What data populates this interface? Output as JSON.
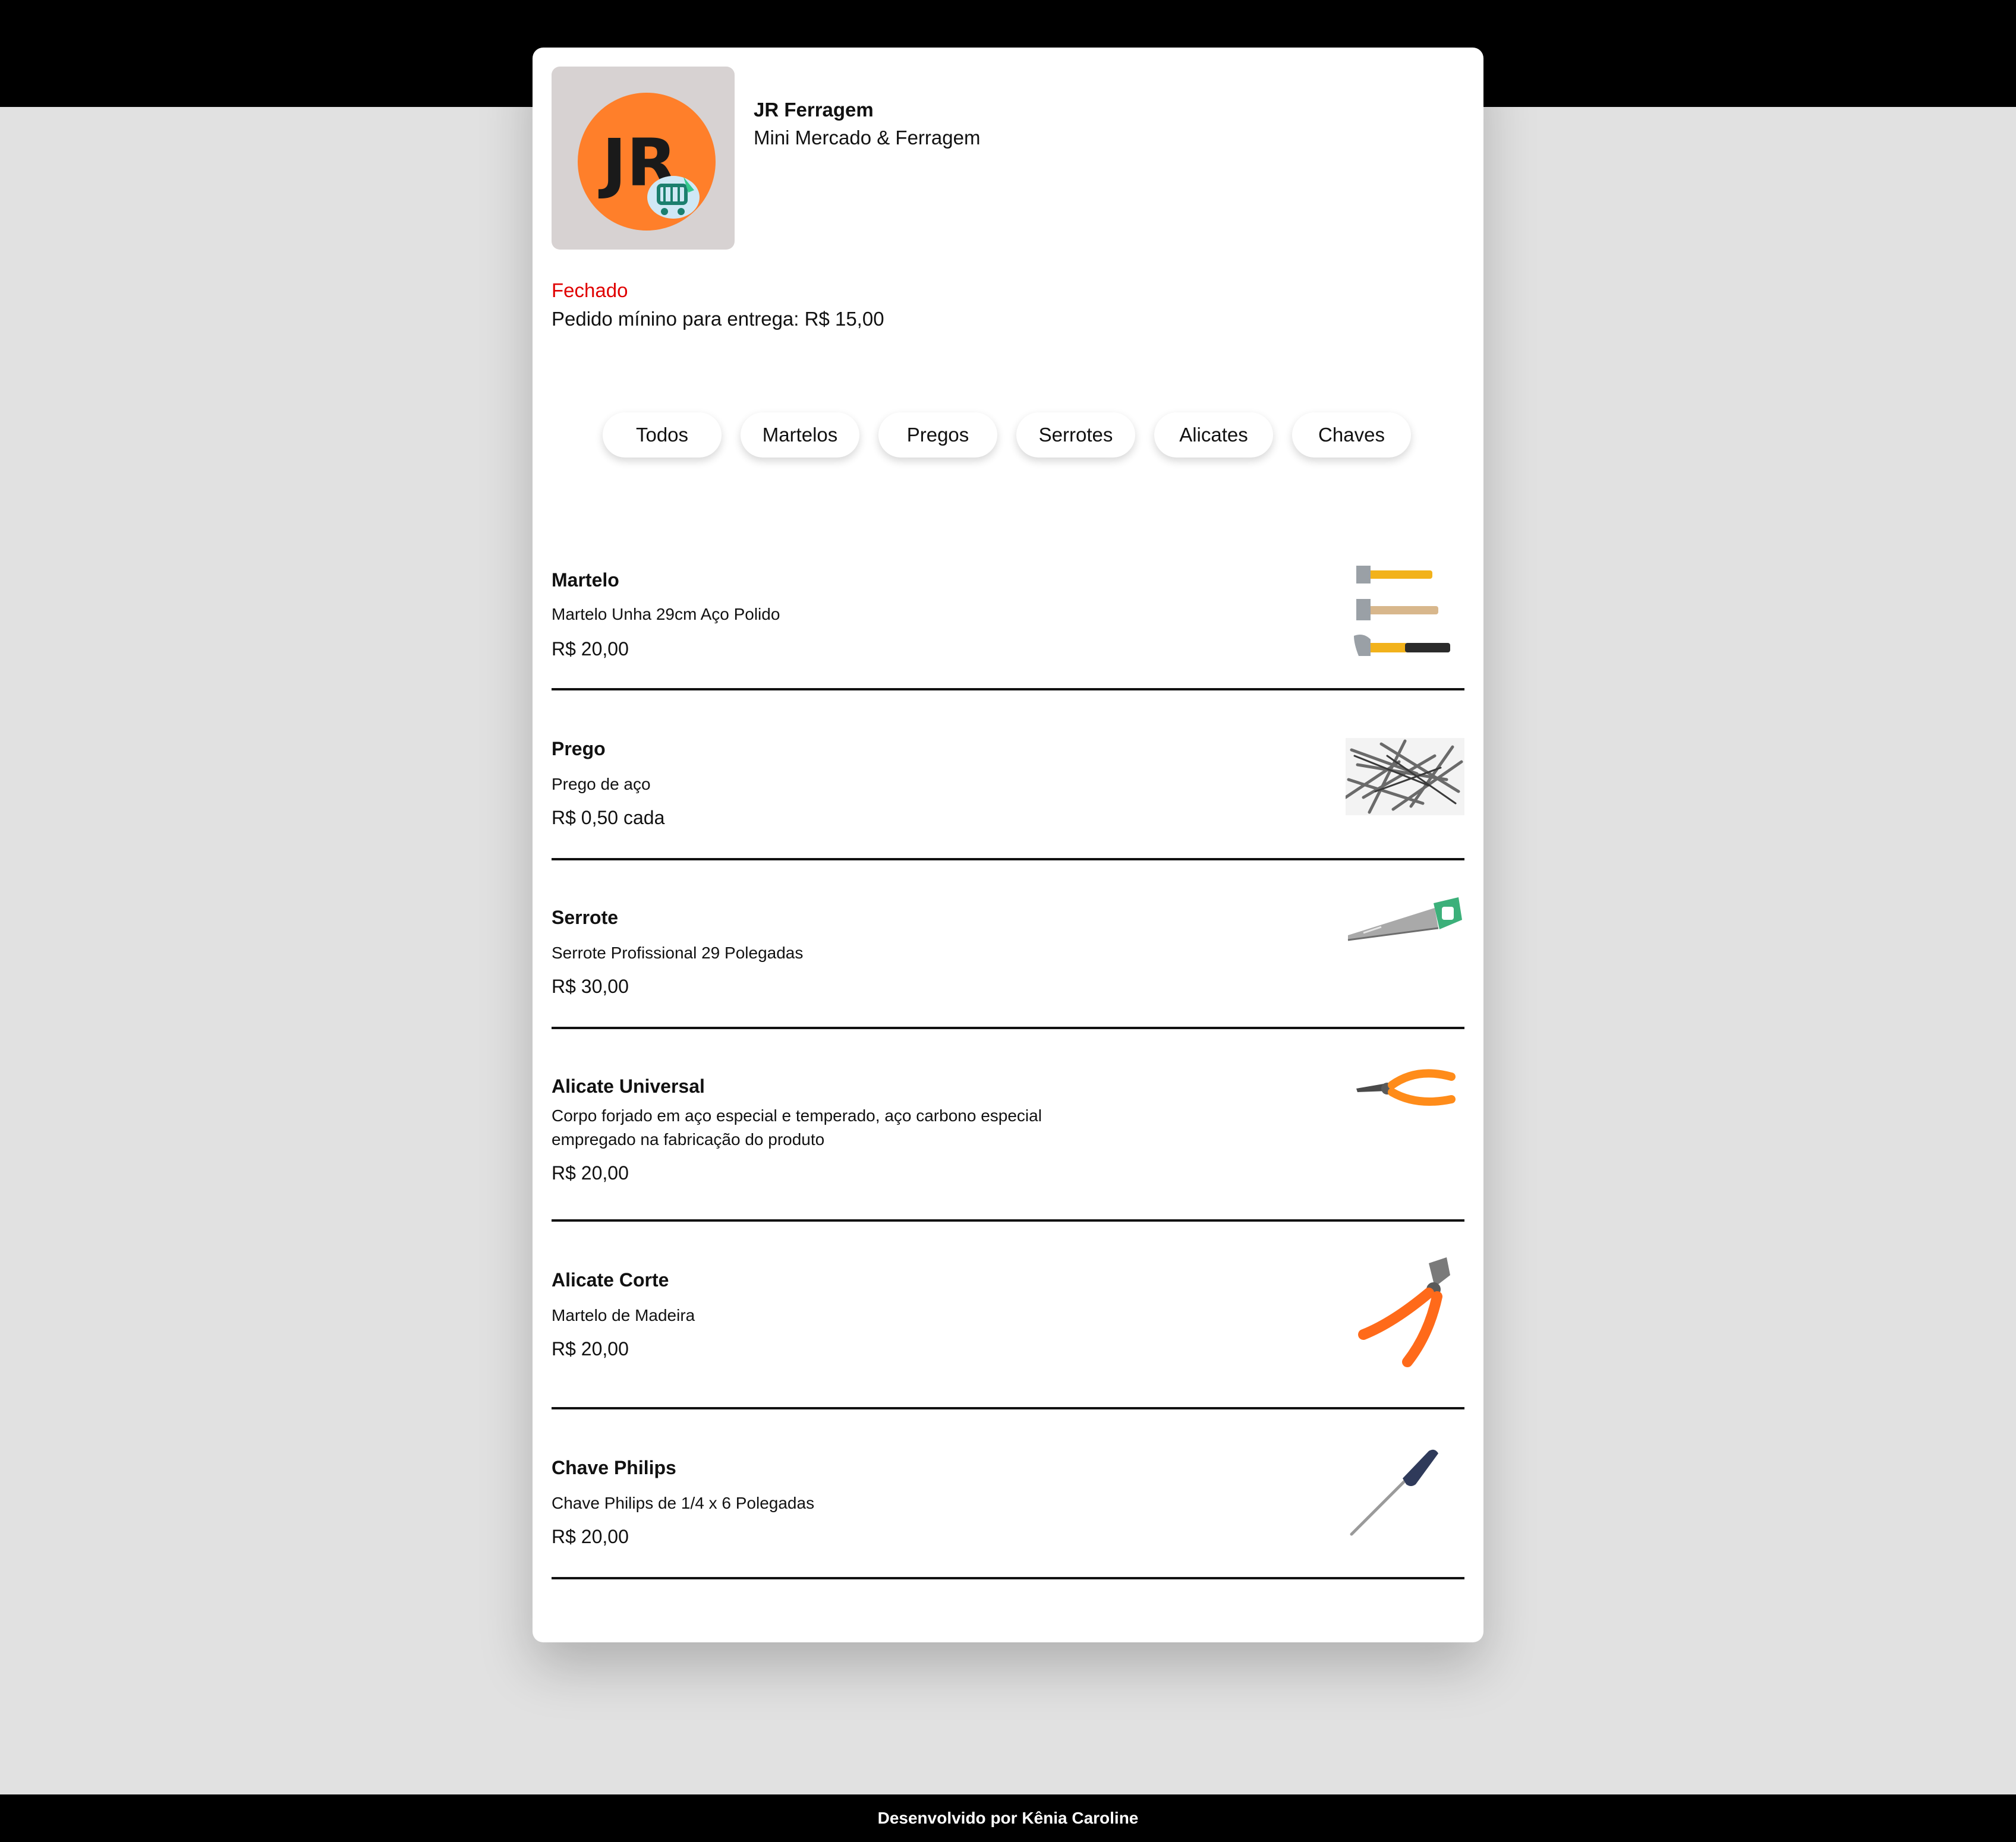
{
  "store": {
    "logo_text": "JR",
    "name": "JR Ferragem",
    "subtitle": "Mini Mercado & Ferragem",
    "status": "Fechado",
    "status_color": "#e00000",
    "min_order": "Pedido mínino para entrega: R$ 15,00"
  },
  "filters": [
    {
      "label": "Todos"
    },
    {
      "label": "Martelos"
    },
    {
      "label": "Pregos"
    },
    {
      "label": "Serrotes"
    },
    {
      "label": "Alicates"
    },
    {
      "label": "Chaves"
    }
  ],
  "products": [
    {
      "title": "Martelo",
      "description": "Martelo Unha 29cm Aço Polido",
      "price": "R$ 20,00",
      "icon": "hammers-image"
    },
    {
      "title": "Prego",
      "description": "Prego de aço",
      "price": "R$ 0,50 cada",
      "icon": "nails-image"
    },
    {
      "title": "Serrote",
      "description": "Serrote Profissional 29 Polegadas",
      "price": "R$ 30,00",
      "icon": "handsaw-image"
    },
    {
      "title": "Alicate Universal",
      "description": "Corpo forjado em aço especial e temperado, aço carbono especial empregado na fabricação do produto",
      "price": "R$ 20,00",
      "icon": "pliers-image"
    },
    {
      "title": "Alicate Corte",
      "description": "Martelo de Madeira",
      "price": "R$ 20,00",
      "icon": "cutting-pliers-image"
    },
    {
      "title": "Chave Philips",
      "description": "Chave Philips de 1/4 x 6 Polegadas",
      "price": "R$ 20,00",
      "icon": "screwdriver-image"
    }
  ],
  "footer": {
    "credit": "Desenvolvido por Kênia Caroline"
  },
  "colors": {
    "background": "#e1e1e1",
    "band": "#000000",
    "logo_orange": "#ff7f2a"
  }
}
